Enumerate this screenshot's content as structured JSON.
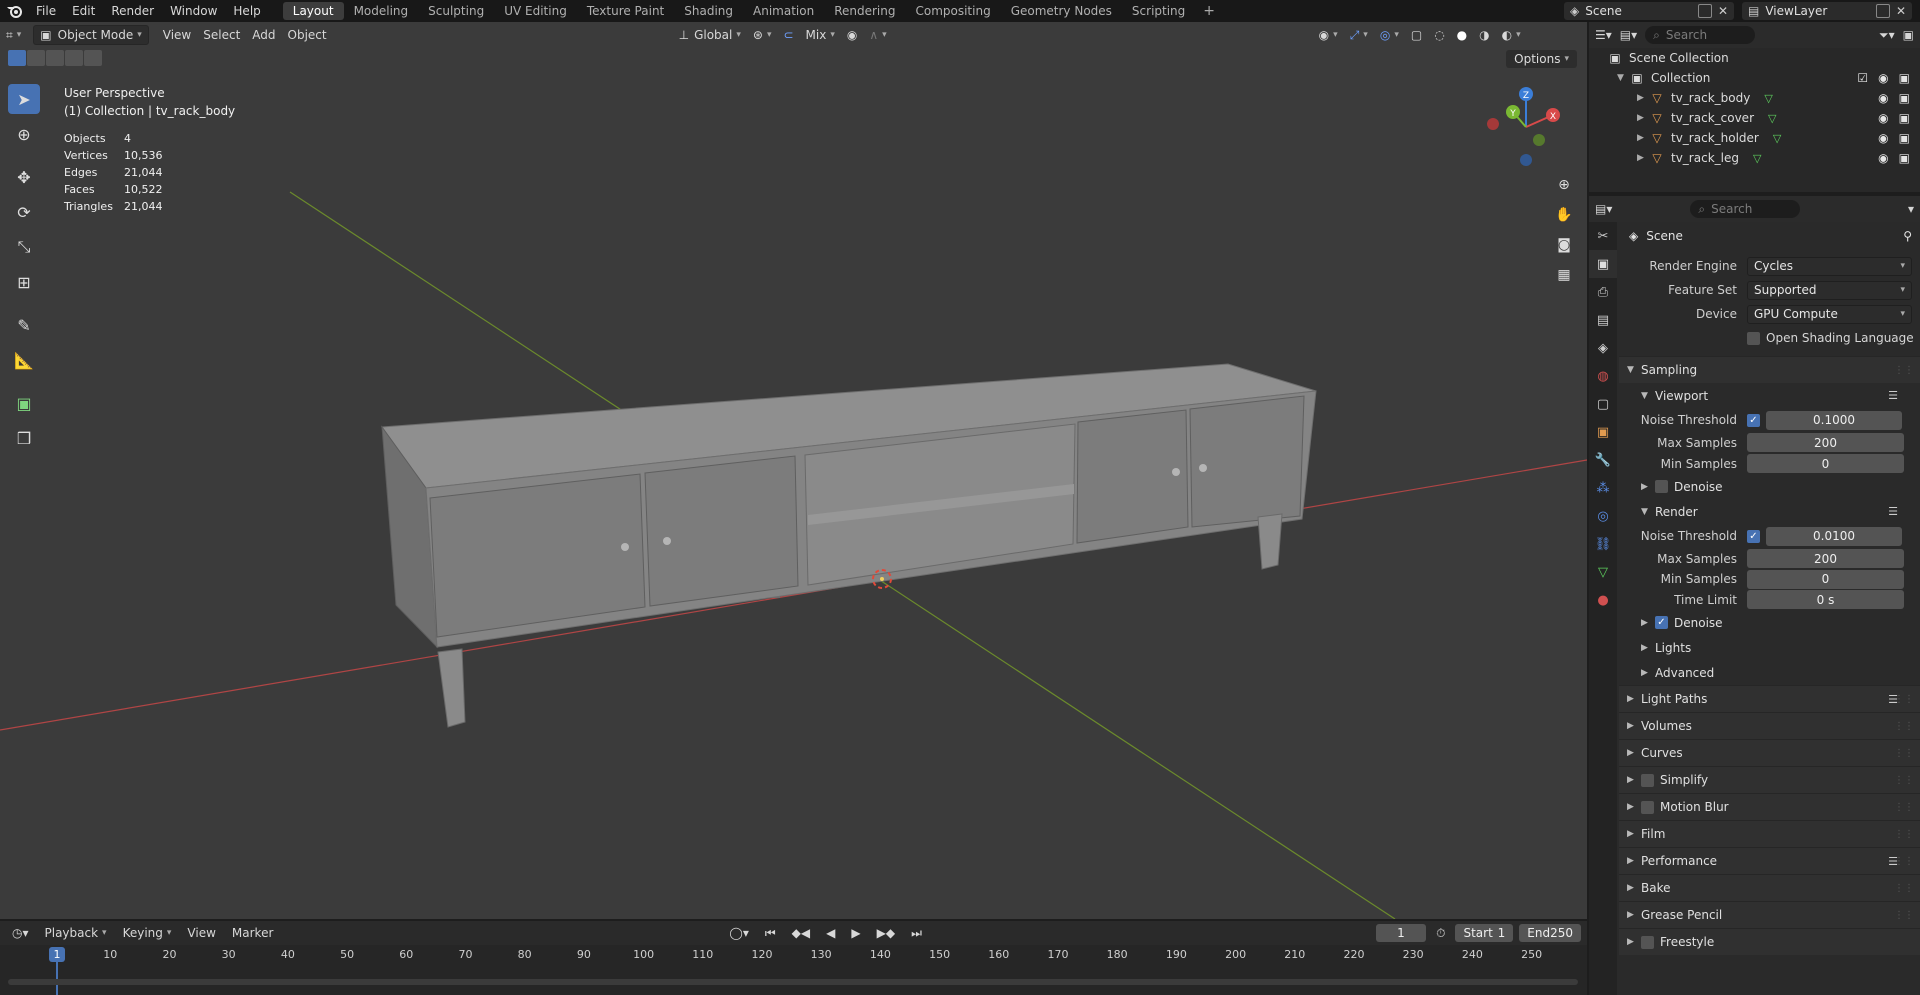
{
  "topbar": {
    "menus": [
      "File",
      "Edit",
      "Render",
      "Window",
      "Help"
    ],
    "workspaces": [
      "Layout",
      "Modeling",
      "Sculpting",
      "UV Editing",
      "Texture Paint",
      "Shading",
      "Animation",
      "Rendering",
      "Compositing",
      "Geometry Nodes",
      "Scripting"
    ],
    "active_workspace": "Layout",
    "scene": "Scene",
    "view_layer": "ViewLayer"
  },
  "viewport": {
    "mode": "Object Mode",
    "menus": [
      "View",
      "Select",
      "Add",
      "Object"
    ],
    "orientation": "Global",
    "snap_mode": "Mix",
    "options_label": "Options",
    "perspective_label": "User Perspective",
    "collection_label": "(1) Collection | tv_rack_body",
    "stats": [
      {
        "key": "Objects",
        "value": "4"
      },
      {
        "key": "Vertices",
        "value": "10,536"
      },
      {
        "key": "Edges",
        "value": "21,044"
      },
      {
        "key": "Faces",
        "value": "10,522"
      },
      {
        "key": "Triangles",
        "value": "21,044"
      }
    ],
    "gizmo_axes": {
      "x": "X",
      "y": "Y",
      "z": "Z"
    }
  },
  "outliner": {
    "search_placeholder": "Search",
    "scene_collection": "Scene Collection",
    "collection": "Collection",
    "objects": [
      "tv_rack_body",
      "tv_rack_cover",
      "tv_rack_holder",
      "tv_rack_leg"
    ]
  },
  "properties": {
    "search_placeholder": "Search",
    "context": "Scene",
    "render_engine_label": "Render Engine",
    "render_engine": "Cycles",
    "feature_set_label": "Feature Set",
    "feature_set": "Supported",
    "device_label": "Device",
    "device": "GPU Compute",
    "osl_label": "Open Shading Language",
    "sampling": "Sampling",
    "viewport_head": "Viewport",
    "render_head": "Render",
    "noise_threshold_label": "Noise Threshold",
    "max_samples_label": "Max Samples",
    "min_samples_label": "Min Samples",
    "time_limit_label": "Time Limit",
    "denoise_label": "Denoise",
    "viewport_noise": "0.1000",
    "viewport_max": "200",
    "viewport_min": "0",
    "render_noise": "0.0100",
    "render_max": "200",
    "render_min": "0",
    "render_time_limit": "0 s",
    "lights": "Lights",
    "advanced": "Advanced",
    "panels": [
      "Light Paths",
      "Volumes",
      "Curves",
      "Simplify",
      "Motion Blur",
      "Film",
      "Performance",
      "Bake",
      "Grease Pencil",
      "Freestyle"
    ]
  },
  "timeline": {
    "menus": [
      "Playback",
      "Keying",
      "View",
      "Marker"
    ],
    "current_frame": "1",
    "start_label": "Start",
    "start": "1",
    "end_label": "End",
    "end": "250",
    "ticks": [
      "1",
      "10",
      "20",
      "30",
      "40",
      "50",
      "60",
      "70",
      "80",
      "90",
      "100",
      "110",
      "120",
      "130",
      "140",
      "150",
      "160",
      "170",
      "180",
      "190",
      "200",
      "210",
      "220",
      "230",
      "240",
      "250"
    ]
  }
}
